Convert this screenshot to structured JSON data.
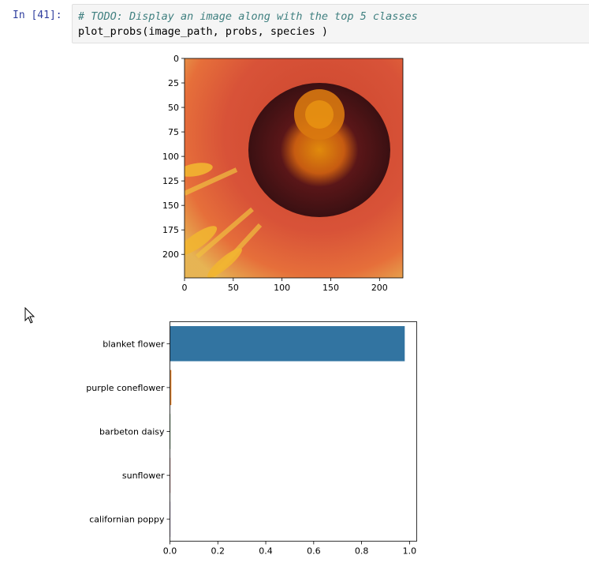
{
  "cell": {
    "prompt": "In [41]:",
    "code_comment": "# TODO: Display an image along with the top 5 classes",
    "code_line": "plot_probs(image_path, probs, species )"
  },
  "image_plot": {
    "xticks": [
      "0",
      "50",
      "100",
      "150",
      "200"
    ],
    "yticks": [
      "0",
      "25",
      "50",
      "75",
      "100",
      "125",
      "150",
      "175",
      "200"
    ]
  },
  "chart_data": {
    "type": "bar",
    "orientation": "horizontal",
    "categories": [
      "blanket flower",
      "purple coneflower",
      "barbeton daisy",
      "sunflower",
      "californian poppy"
    ],
    "values": [
      0.98,
      0.006,
      0.002,
      0.001,
      0.001
    ],
    "colors": [
      "#3274a1",
      "#e1812c",
      "#3a923a",
      "#c03d3e",
      "#9372b2"
    ],
    "xlim": [
      0,
      1.03
    ],
    "xticks": [
      "0.0",
      "0.2",
      "0.4",
      "0.6",
      "0.8",
      "1.0"
    ],
    "title": "",
    "xlabel": "",
    "ylabel": ""
  }
}
